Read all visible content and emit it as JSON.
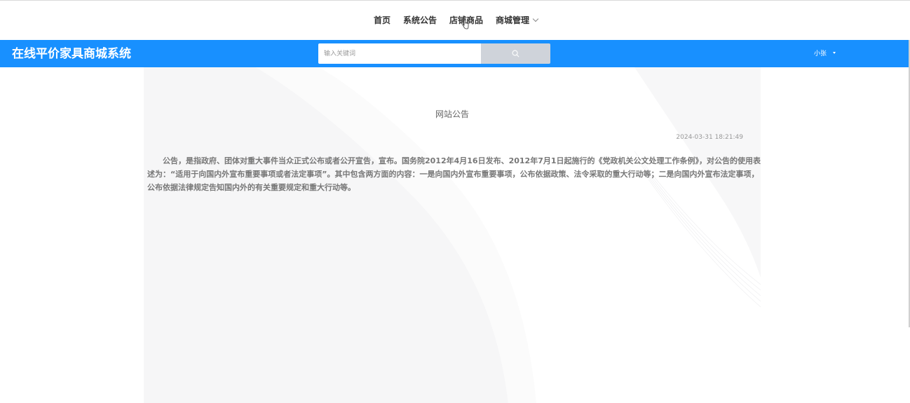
{
  "nav": {
    "items": [
      {
        "label": "首页"
      },
      {
        "label": "系统公告"
      },
      {
        "label": "店铺商品"
      },
      {
        "label": "商城管理"
      }
    ]
  },
  "header": {
    "brand": "在线平价家具商城系统",
    "search_placeholder": "输入关键词",
    "user": "小张"
  },
  "notice": {
    "title": "网站公告",
    "date": "2024-03-31 18:21:49",
    "body": "公告，是指政府、团体对重大事件当众正式公布或者公开宣告，宣布。国务院2012年4月16日发布、2012年7月1日起施行的《党政机关公文处理工作条例》，对公告的使用表述为：“适用于向国内外宣布重要事项或者法定事项”。其中包含两方面的内容：一是向国内外宣布重要事项，公布依据政策、法令采取的重大行动等；二是向国内外宣布法定事项，公布依据法律规定告知国内外的有关重要规定和重大行动等。"
  },
  "colors": {
    "accent": "#1890ff",
    "search_button": "#cfd3da"
  },
  "icons": {
    "search": "search-icon",
    "chevron": "chevron-down-icon",
    "caret": "caret-down-icon",
    "cursor": "hand-cursor-icon"
  }
}
